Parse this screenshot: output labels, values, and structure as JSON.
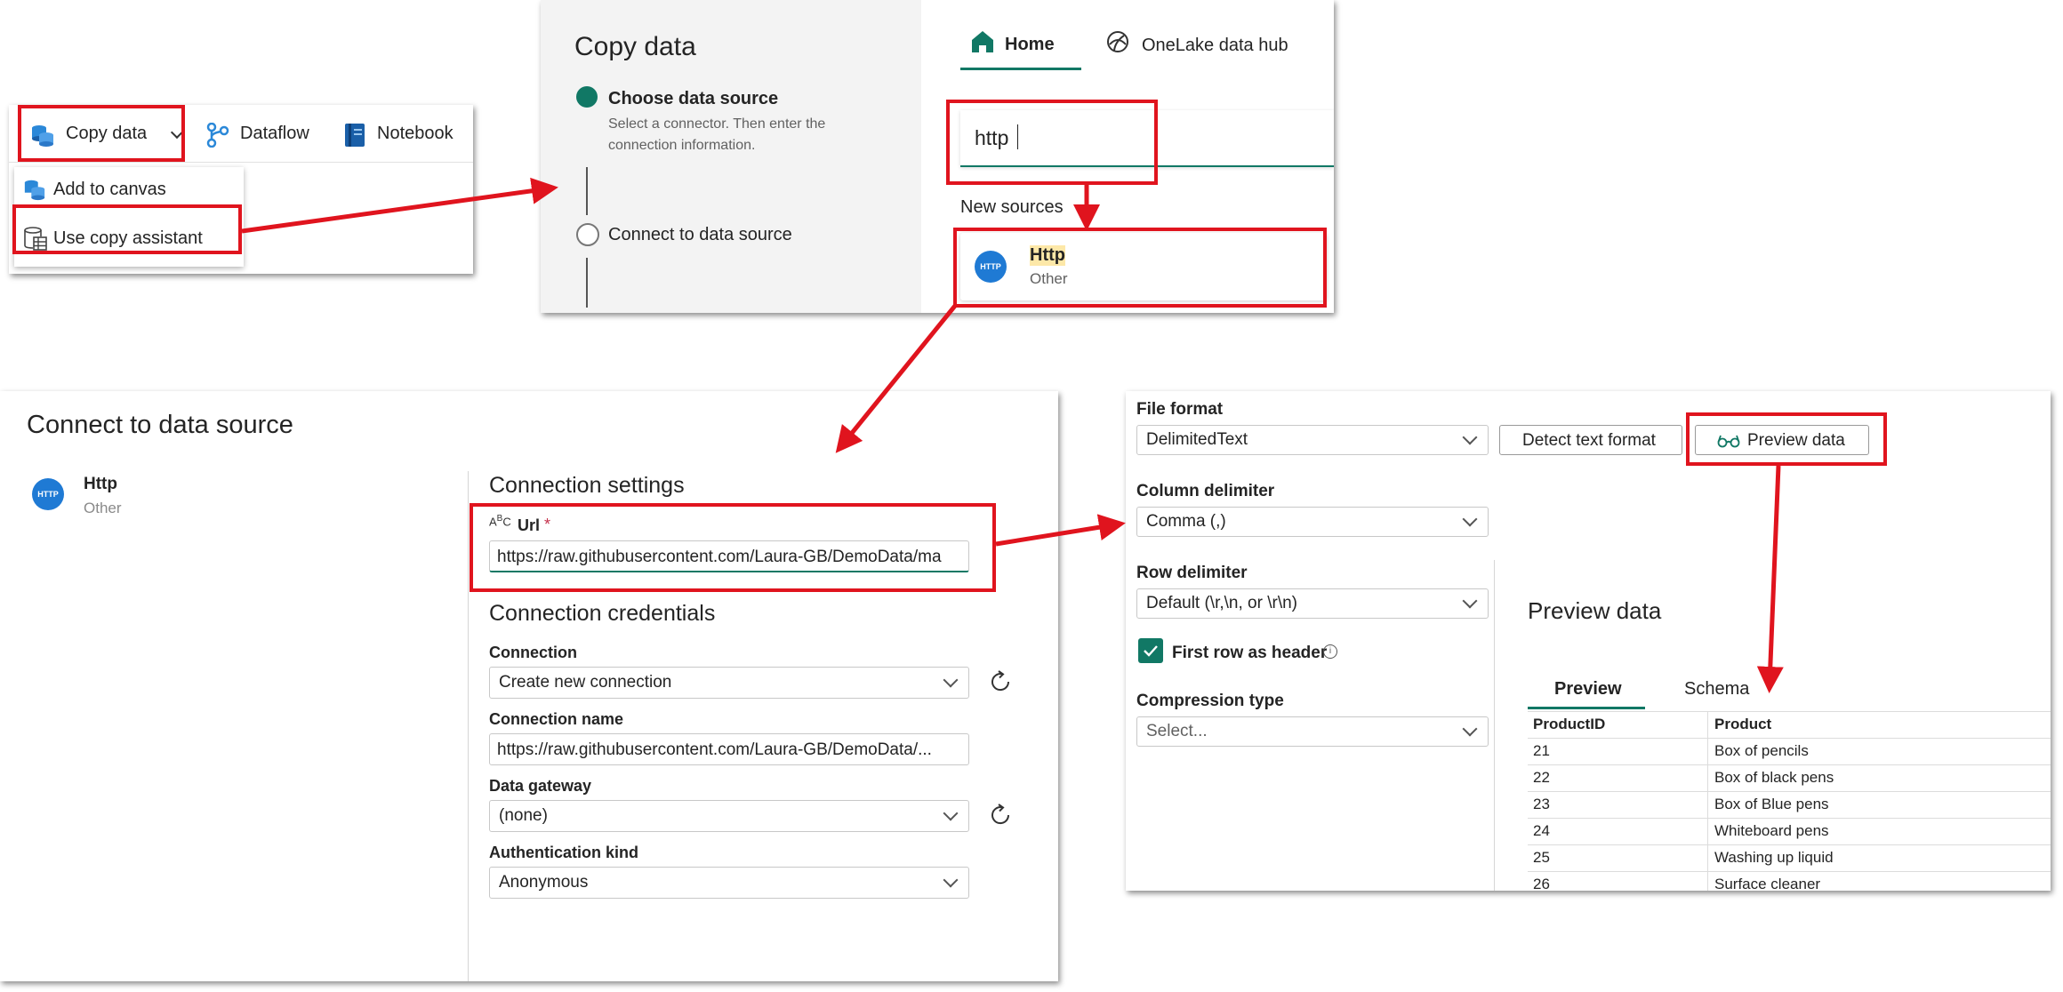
{
  "toolbar": {
    "copy_data": "Copy data",
    "dataflow": "Dataflow",
    "notebook": "Notebook",
    "menu_items": [
      "Add to canvas",
      "Use copy assistant"
    ]
  },
  "copy_wizard": {
    "title": "Copy data",
    "steps": [
      {
        "title": "Choose data source",
        "desc_line1": "Select a connector. Then enter the",
        "desc_line2": "connection information."
      },
      {
        "title": "Connect to data source"
      }
    ],
    "tabs": [
      "Home",
      "OneLake data hub"
    ],
    "search_value": "http",
    "new_sources_label": "New sources",
    "source_card": {
      "name": "Http",
      "category": "Other",
      "icon_text": "HTTP"
    }
  },
  "connect": {
    "title": "Connect to data source",
    "source_name": "Http",
    "source_category": "Other",
    "icon_text": "HTTP",
    "settings_heading": "Connection settings",
    "url_label": "Url",
    "url_required": "*",
    "url_value": "https://raw.githubusercontent.com/Laura-GB/DemoData/ma",
    "credentials_heading": "Connection credentials",
    "connection_label": "Connection",
    "connection_value": "Create new connection",
    "connection_name_label": "Connection name",
    "connection_name_value": "https://raw.githubusercontent.com/Laura-GB/DemoData/...",
    "gateway_label": "Data gateway",
    "gateway_value": "(none)",
    "auth_label": "Authentication kind",
    "auth_value": "Anonymous"
  },
  "format": {
    "file_format_label": "File format",
    "file_format_value": "DelimitedText",
    "detect_button": "Detect text format",
    "preview_button": "Preview data",
    "column_delim_label": "Column delimiter",
    "column_delim_value": "Comma (,)",
    "row_delim_label": "Row delimiter",
    "row_delim_value": "Default (\\r,\\n, or \\r\\n)",
    "first_row_header_label": "First row as header",
    "first_row_header_checked": true,
    "compression_label": "Compression type",
    "compression_placeholder": "Select..."
  },
  "preview": {
    "title": "Preview data",
    "tabs": [
      "Preview",
      "Schema"
    ],
    "columns": [
      "ProductID",
      "Product"
    ],
    "rows": [
      [
        "21",
        "Box of pencils"
      ],
      [
        "22",
        "Box of black pens"
      ],
      [
        "23",
        "Box of Blue pens"
      ],
      [
        "24",
        "Whiteboard pens"
      ],
      [
        "25",
        "Washing up liquid"
      ],
      [
        "26",
        "Surface cleaner"
      ]
    ]
  },
  "colors": {
    "accent_green": "#117865",
    "highlight_red": "#e0141e",
    "http_blue": "#1f7ad4"
  }
}
